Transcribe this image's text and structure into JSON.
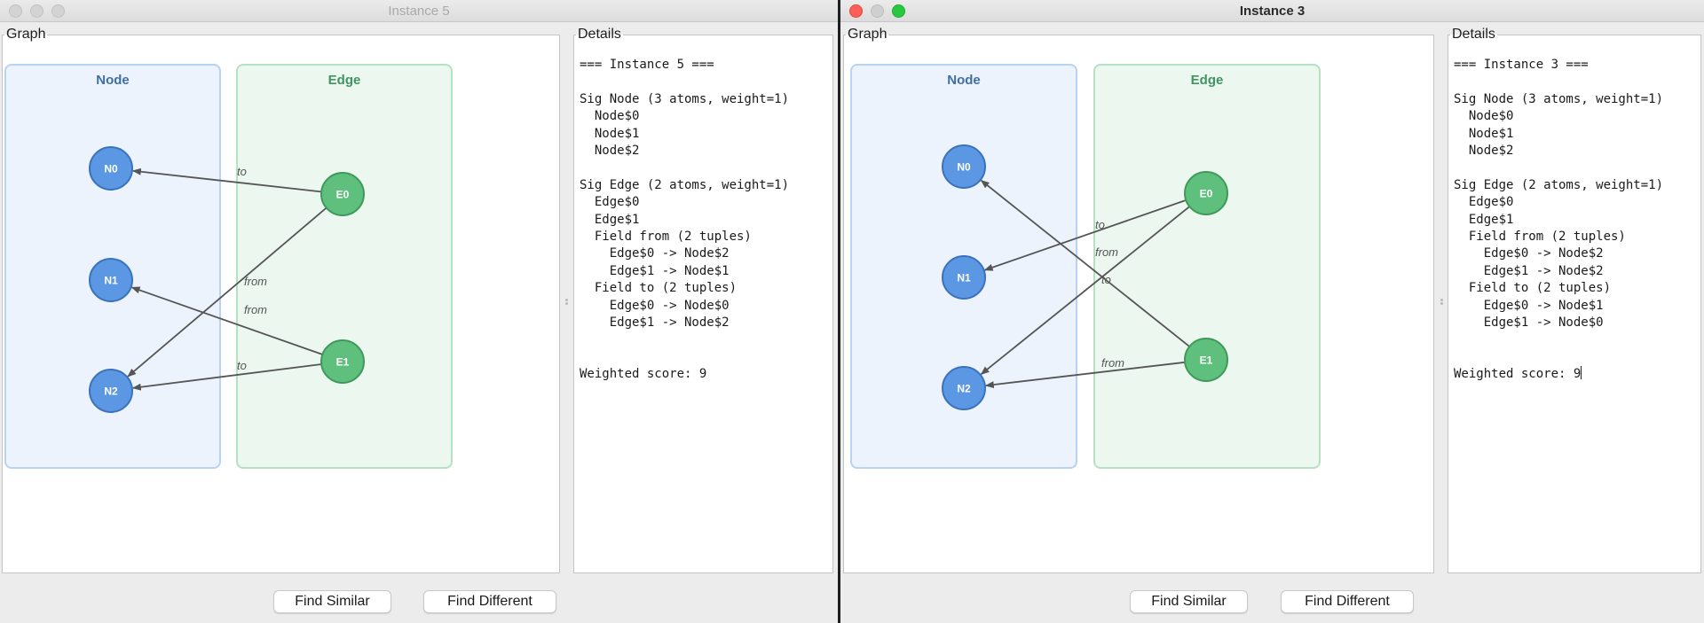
{
  "windows": [
    {
      "title": "Instance 5",
      "graph_label": "Graph",
      "details_label": "Details",
      "graph": {
        "groups": [
          "Node",
          "Edge"
        ],
        "nodes": [
          "N0",
          "N1",
          "N2"
        ],
        "edges_atoms": [
          "E0",
          "E1"
        ],
        "arrows": [
          {
            "from": "E0",
            "to": "N0",
            "label": "to"
          },
          {
            "from": "E0",
            "to": "N2",
            "label": "from"
          },
          {
            "from": "E1",
            "to": "N1",
            "label": "from"
          },
          {
            "from": "E1",
            "to": "N2",
            "label": "to"
          }
        ]
      },
      "details_lines": [
        "=== Instance 5 ===",
        "",
        "Sig Node (3 atoms, weight=1)",
        "  Node$0",
        "  Node$1",
        "  Node$2",
        "",
        "Sig Edge (2 atoms, weight=1)",
        "  Edge$0",
        "  Edge$1",
        "  Field from (2 tuples)",
        "    Edge$0 -> Node$2",
        "    Edge$1 -> Node$1",
        "  Field to (2 tuples)",
        "    Edge$0 -> Node$0",
        "    Edge$1 -> Node$2",
        "",
        "",
        "Weighted score: 9"
      ],
      "buttons": {
        "similar": "Find Similar",
        "different": "Find Different"
      }
    },
    {
      "title": "Instance 3",
      "graph_label": "Graph",
      "details_label": "Details",
      "graph": {
        "groups": [
          "Node",
          "Edge"
        ],
        "nodes": [
          "N0",
          "N1",
          "N2"
        ],
        "edges_atoms": [
          "E0",
          "E1"
        ],
        "arrows": [
          {
            "from": "E0",
            "to": "N1",
            "label": "to"
          },
          {
            "from": "E0",
            "to": "N2",
            "label": "from"
          },
          {
            "from": "E1",
            "to": "N0",
            "label": "to"
          },
          {
            "from": "E1",
            "to": "N2",
            "label": "from"
          }
        ]
      },
      "details_lines": [
        "=== Instance 3 ===",
        "",
        "Sig Node (3 atoms, weight=1)",
        "  Node$0",
        "  Node$1",
        "  Node$2",
        "",
        "Sig Edge (2 atoms, weight=1)",
        "  Edge$0",
        "  Edge$1",
        "  Field from (2 tuples)",
        "    Edge$0 -> Node$2",
        "    Edge$1 -> Node$2",
        "  Field to (2 tuples)",
        "    Edge$0 -> Node$1",
        "    Edge$1 -> Node$0",
        "",
        "",
        "Weighted score: 9"
      ],
      "buttons": {
        "similar": "Find Similar",
        "different": "Find Different"
      }
    }
  ],
  "colors": {
    "node_fill": "#5b97e2",
    "node_stroke": "#3a72bd",
    "edge_fill": "#5fbf7d",
    "edge_stroke": "#3e9a5a",
    "node_group_bg": "#ecf3fc",
    "node_group_border": "#b9d2ee",
    "node_group_title": "#3f6ea8",
    "edge_group_bg": "#ebf7ef",
    "edge_group_border": "#b6e0c2",
    "edge_group_title": "#3f9461",
    "arrow": "#555555"
  }
}
